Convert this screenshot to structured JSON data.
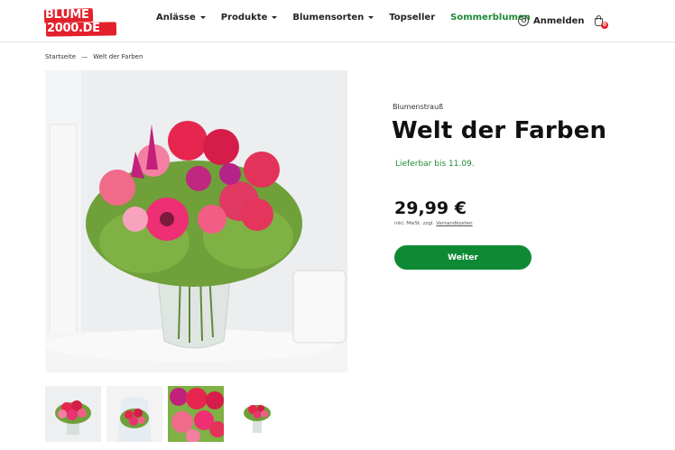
{
  "brand": {
    "logo_line1": "BLUME",
    "logo_line2": "2000.DE",
    "color": "#e3202b"
  },
  "nav": {
    "items": [
      {
        "label": "Anlässe",
        "has_dropdown": true
      },
      {
        "label": "Produkte",
        "has_dropdown": true
      },
      {
        "label": "Blumensorten",
        "has_dropdown": true
      },
      {
        "label": "Topseller",
        "has_dropdown": false
      },
      {
        "label": "Sommerblumen",
        "has_dropdown": false,
        "accent": "#1e8a36"
      }
    ],
    "login_label": "Anmelden",
    "login_icon": "user-icon",
    "cart_icon": "shopping-bag-icon",
    "cart_count": "0"
  },
  "breadcrumb": {
    "home": "Startseite",
    "separator": "—",
    "current": "Welt der Farben"
  },
  "product": {
    "category": "Blumenstrauß",
    "title": "Welt der Farben",
    "availability": "Lieferbar bis 11.09.",
    "price": "29,99 €",
    "tax_note": "inkl. MwSt. zzgl.",
    "shipping_link": "Versandkosten",
    "button_label": "Weiter",
    "button_color": "#0f8a34"
  },
  "thumbnails": [
    {
      "icon": "bouquet-thumbnail"
    },
    {
      "icon": "person-holding-bouquet-thumbnail"
    },
    {
      "icon": "bouquet-closeup-thumbnail"
    },
    {
      "icon": "bouquet-small-thumbnail"
    }
  ]
}
